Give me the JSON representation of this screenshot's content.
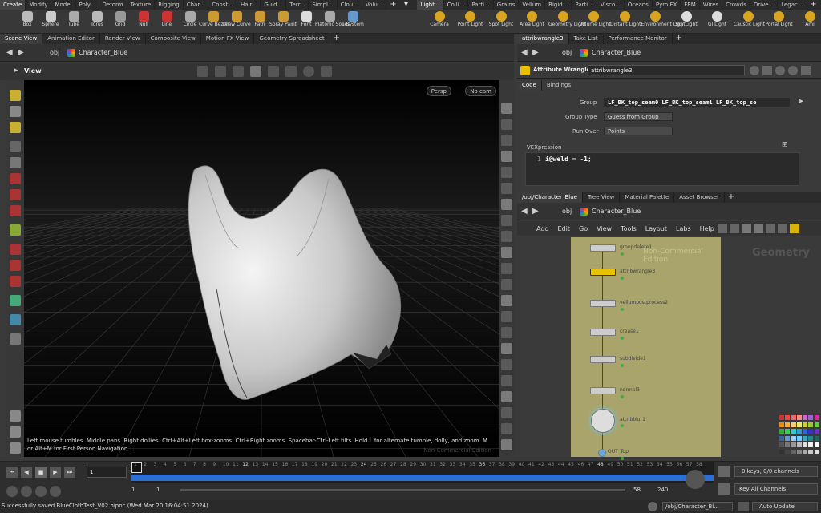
{
  "shelf_tabs_left": [
    "Create",
    "Modify",
    "Model",
    "Poly...",
    "Deform",
    "Texture",
    "Rigging",
    "Char...",
    "Const...",
    "Hair...",
    "Guid...",
    "Terr...",
    "Simpl...",
    "Clou...",
    "Volu..."
  ],
  "shelf_tabs_right": [
    "Light...",
    "Colli...",
    "Parti...",
    "Grains",
    "Vellum",
    "Rigid...",
    "Parti...",
    "Visco...",
    "Oceans",
    "Pyro FX",
    "FEM",
    "Wires",
    "Crowds",
    "Drive...",
    "Legac..."
  ],
  "shelf_tools_left": [
    "Box",
    "Sphere",
    "Tube",
    "Torus",
    "Grid",
    "Null",
    "Line",
    "Circle",
    "Curve Bezier",
    "Draw Curve",
    "Path",
    "Spray Paint",
    "Font",
    "Platonic Solids",
    "L-System"
  ],
  "shelf_tools_right": [
    "Camera",
    "Point Light",
    "Spot Light",
    "Area Light",
    "Geometry Light",
    "Volume Light",
    "Distant Light",
    "Environment Light",
    "Sky Light",
    "GI Light",
    "Caustic Light",
    "Portal Light",
    "Ami"
  ],
  "left_pane_tabs": [
    "Scene View",
    "Animation Editor",
    "Render View",
    "Composite View",
    "Motion FX View",
    "Geometry Spreadsheet"
  ],
  "right_pane_tabs": [
    "attribwrangle3",
    "Take List",
    "Performance Monitor"
  ],
  "path_obj": "obj",
  "path_character": "Character_Blue",
  "viewport": {
    "title": "View",
    "persp": "Persp",
    "cam": "No cam",
    "help_text": "Left mouse tumbles. Middle pans. Right dollies. Ctrl+Alt+Left box-zooms. Ctrl+Right zooms. Spacebar-Ctrl-Left tilts. Hold L for alternate tumble, dolly, and zoom.     M or Alt+M for First Person Navigation.",
    "watermark": "Non-Commercial Edition"
  },
  "wrangle": {
    "type_label": "Attribute Wrangle",
    "node_name": "attribwrangle3",
    "tabs": [
      "Code",
      "Bindings"
    ],
    "group_label": "Group",
    "group_value": "LF_BK_top_seam0 LF_BK_top_seam1 LF_BK_top_se",
    "group_type_label": "Group Type",
    "group_type_value": "Guess from Group",
    "run_over_label": "Run Over",
    "run_over_value": "Points",
    "vex_label": "VEXpression",
    "code_line_no": "1",
    "code": "i@weld = -1;"
  },
  "network_tabs": [
    "/obj/Character_Blue",
    "Tree View",
    "Material Palette",
    "Asset Browser"
  ],
  "network_menu": [
    "Add",
    "Edit",
    "Go",
    "View",
    "Tools",
    "Layout",
    "Labs",
    "Help"
  ],
  "network_watermark": "Non-Commercial Edition",
  "network_context": "Geometry",
  "nodes": [
    "groupdelete1",
    "attribwrangle3",
    "vellumpostprocess2",
    "crease1",
    "subdivide1",
    "normal3",
    "attribblur1",
    "OUT_Top"
  ],
  "timeline": {
    "frame": "1",
    "ticks": [
      "1",
      "2",
      "3",
      "4",
      "5",
      "6",
      "7",
      "8",
      "9",
      "10",
      "11",
      "12",
      "13",
      "14",
      "15",
      "16",
      "17",
      "18",
      "19",
      "20",
      "21",
      "22",
      "23",
      "24",
      "25",
      "26",
      "27",
      "28",
      "29",
      "30",
      "31",
      "32",
      "33",
      "34",
      "35",
      "36",
      "37",
      "38",
      "39",
      "40",
      "41",
      "42",
      "43",
      "44",
      "45",
      "46",
      "47",
      "48",
      "49",
      "50",
      "51",
      "52",
      "53",
      "54",
      "55",
      "56",
      "57",
      "58"
    ],
    "range_start": "1",
    "range_start2": "1",
    "range_end": "58",
    "range_end2": "240",
    "keys": "0 keys, 0/0 channels",
    "key_all": "Key All Channels"
  },
  "status": {
    "message": "Successfully saved BlueClothTest_V02.hipnc (Wed Mar 20 16:04:51 2024)",
    "path": "/obj/Character_Bl...",
    "update": "Auto Update"
  },
  "colors": {
    "accent": "#e8c200",
    "network_bg": "#a9a46c",
    "timeline_blue": "#2b6fd6"
  }
}
